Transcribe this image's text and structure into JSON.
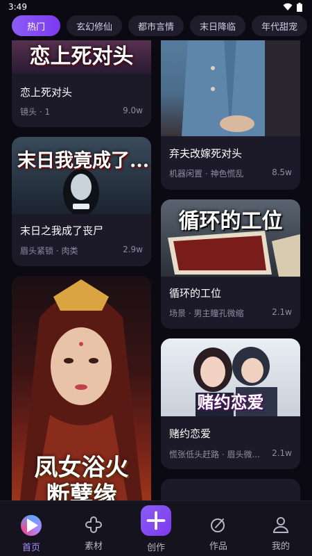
{
  "status_bar": {
    "time": "3:49"
  },
  "tabs": [
    {
      "label": "热门"
    },
    {
      "label": "玄幻修仙"
    },
    {
      "label": "都市言情"
    },
    {
      "label": "末日降临"
    },
    {
      "label": "年代甜宠"
    }
  ],
  "cards": {
    "c1": {
      "title": "恋上死对头",
      "tags": "镜头 · 1",
      "count": "9.0w",
      "cover_text": "恋上死对头"
    },
    "c2": {
      "title": "弃夫改嫁死对头",
      "tags": "机器闲置 · 神色慌乱",
      "count": "8.5w"
    },
    "c3": {
      "title": "末日之我成了丧尸",
      "tags": "眉头紧锁 · 肉类",
      "count": "2.9w",
      "cover_text": "末日我竟成了..."
    },
    "c4": {
      "title": "循环的工位",
      "tags": "场景 · 男主瞳孔微缩",
      "count": "2.1w",
      "cover_text": "循环的工位"
    },
    "c5": {
      "cover_text_1": "凤女浴火",
      "cover_text_2": "断孽缘"
    },
    "c6": {
      "title": "赌约恋爱",
      "tags": "慌张低头赶路 · 眉头微...",
      "count": "2.1w",
      "cover_text": "赌约恋爱"
    }
  },
  "nav": {
    "home": "首页",
    "material": "素材",
    "create": "创作",
    "works": "作品",
    "mine": "我的"
  },
  "colors": {
    "accent": "#8b5cf6",
    "background": "#0b0a12",
    "card": "#1c1a29"
  }
}
